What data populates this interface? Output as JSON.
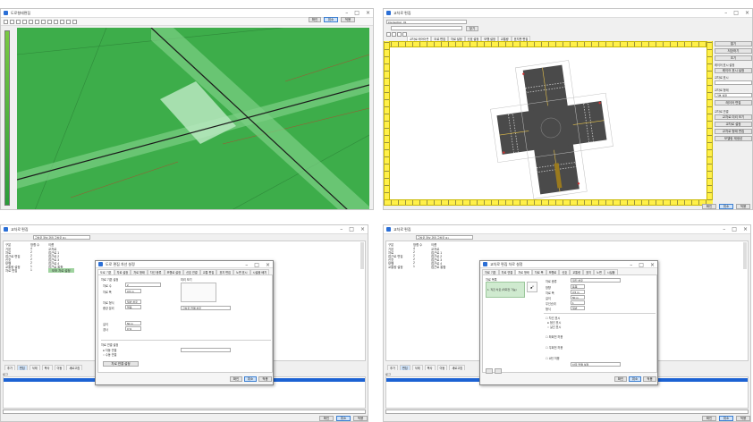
{
  "colors": {
    "map_green": "#3dad4a",
    "ruler_yellow": "#fff04a",
    "selection_blue": "#1c62d3",
    "road_gray": "#4a4a4a",
    "crosswalk": "#9a7a1e"
  },
  "tl": {
    "title": "도로형태편집",
    "buttons": [
      "확인",
      "취소",
      "적용"
    ]
  },
  "tr": {
    "title": "교차로 편집",
    "project_field": "intersection_01",
    "search_button": "찾기",
    "tabs": [
      "교차로 레이아웃",
      "도로 편집",
      "차로 설정",
      "신호 설정",
      "보행 설정",
      "교통량",
      "표지판 편집"
    ],
    "right_buttons": [
      "열기",
      "저장하기",
      "초기",
      "레이어 표시 설정",
      "레이어 편집",
      "교차로 미리 보기",
      "교차로 설정",
      "교차로 형태 편집",
      "모델링 재생성"
    ],
    "right_labels": [
      "레이어 표시 설정",
      "교차로 표시",
      "교차로 형태",
      "교차로 연결"
    ],
    "right_dropdown": "기본 설정",
    "bottom_buttons": [
      "확인",
      "취소",
      "적용"
    ]
  },
  "bl": {
    "title": "교차로 편집",
    "field": "교차로 정보 관리 교차로 (1)",
    "list_headers": [
      "구분",
      "방향 수",
      "이름"
    ],
    "list_rows": [
      [
        "기본",
        "4",
        "교차로"
      ],
      [
        "차로",
        "2",
        "접근로 1"
      ],
      [
        "접근로 편집",
        "2",
        "접근로 2"
      ],
      [
        "신호",
        "2",
        "접근로 3"
      ],
      [
        "보행",
        "2",
        "접근로 4"
      ],
      [
        "교통량 설정",
        "1",
        "접근로 통합"
      ],
      [
        "차로 편집",
        "1",
        "보조 차로 설정"
      ]
    ],
    "bottom_tabs": [
      "추가",
      "편집",
      "삭제",
      "복사",
      "이동",
      "새로고침"
    ],
    "log_label": "로그",
    "log_selected": "교차로 정보 로드 완료",
    "footer_buttons": [
      "확인",
      "취소",
      "적용"
    ],
    "dialog": {
      "title": "도로 편집 차선 설정",
      "tabs": [
        "도로 기본",
        "차로 설정",
        "차로 형태",
        "차선 종류",
        "보행로 설정",
        "신호 연결",
        "교통 편집",
        "표지 편집",
        "노면 표시",
        "시설물 배치"
      ],
      "section1": "차로 기본 설정",
      "labels": [
        "차로 수",
        "차로 폭",
        "차로 형식",
        "중앙 분리",
        "길이",
        "경사"
      ],
      "values": [
        "2",
        "3.5 m",
        "일반 차로",
        "없음",
        "50 m",
        "0 %"
      ],
      "section2": "차로 연결 설정",
      "radio1": "자동 연결",
      "radio2": "수동 연결",
      "link_button": "차로 연결 설정",
      "right_label": "미리 보기",
      "sub_field": "교차로 연결 차로",
      "buttons": [
        "확인",
        "취소",
        "적용"
      ]
    }
  },
  "br": {
    "title": "교차로 편집",
    "field": "교차로 정보 관리 교차로 (1)",
    "list_headers": [
      "구분",
      "방향 수",
      "이름"
    ],
    "list_rows": [
      [
        "기본",
        "4",
        "교차로"
      ],
      [
        "차로",
        "2",
        "접근로 1"
      ],
      [
        "접근로 편집",
        "2",
        "접근로 2"
      ],
      [
        "신호",
        "2",
        "접근로 3"
      ],
      [
        "보행",
        "2",
        "접근로 4"
      ],
      [
        "교통량 설정",
        "1",
        "접근로 통합"
      ]
    ],
    "bottom_tabs": [
      "추가",
      "편집",
      "삭제",
      "복사",
      "이동",
      "새로고침"
    ],
    "log_label": "로그",
    "log_selected": "교차로 정보 로드 완료",
    "footer_buttons": [
      "확인",
      "취소",
      "적용"
    ],
    "dialog": {
      "title": "교차로 편집 차로 설정",
      "tabs": [
        "차로 기본",
        "차로 연결",
        "차로 형태",
        "차로 폭",
        "보행로",
        "신호",
        "교통량",
        "표지",
        "노면",
        "시설물"
      ],
      "list_title": "차로 목록",
      "list_item": "1. 직진 차로 (좌회전 가능)",
      "labels": [
        "차로 종류",
        "방향",
        "차로 폭",
        "길이",
        "우선순위",
        "형식"
      ],
      "values": [
        "직진 차로",
        "동쪽",
        "3.5 m",
        "50 m",
        "1",
        "일반"
      ],
      "options": [
        "차선 표시",
        "점선 표시",
        "실선 표시",
        "좌회전 허용",
        "우회전 허용",
        "U턴 허용"
      ],
      "sub_field": "차로 연결 설정",
      "buttons": [
        "확인",
        "취소",
        "적용"
      ]
    }
  }
}
